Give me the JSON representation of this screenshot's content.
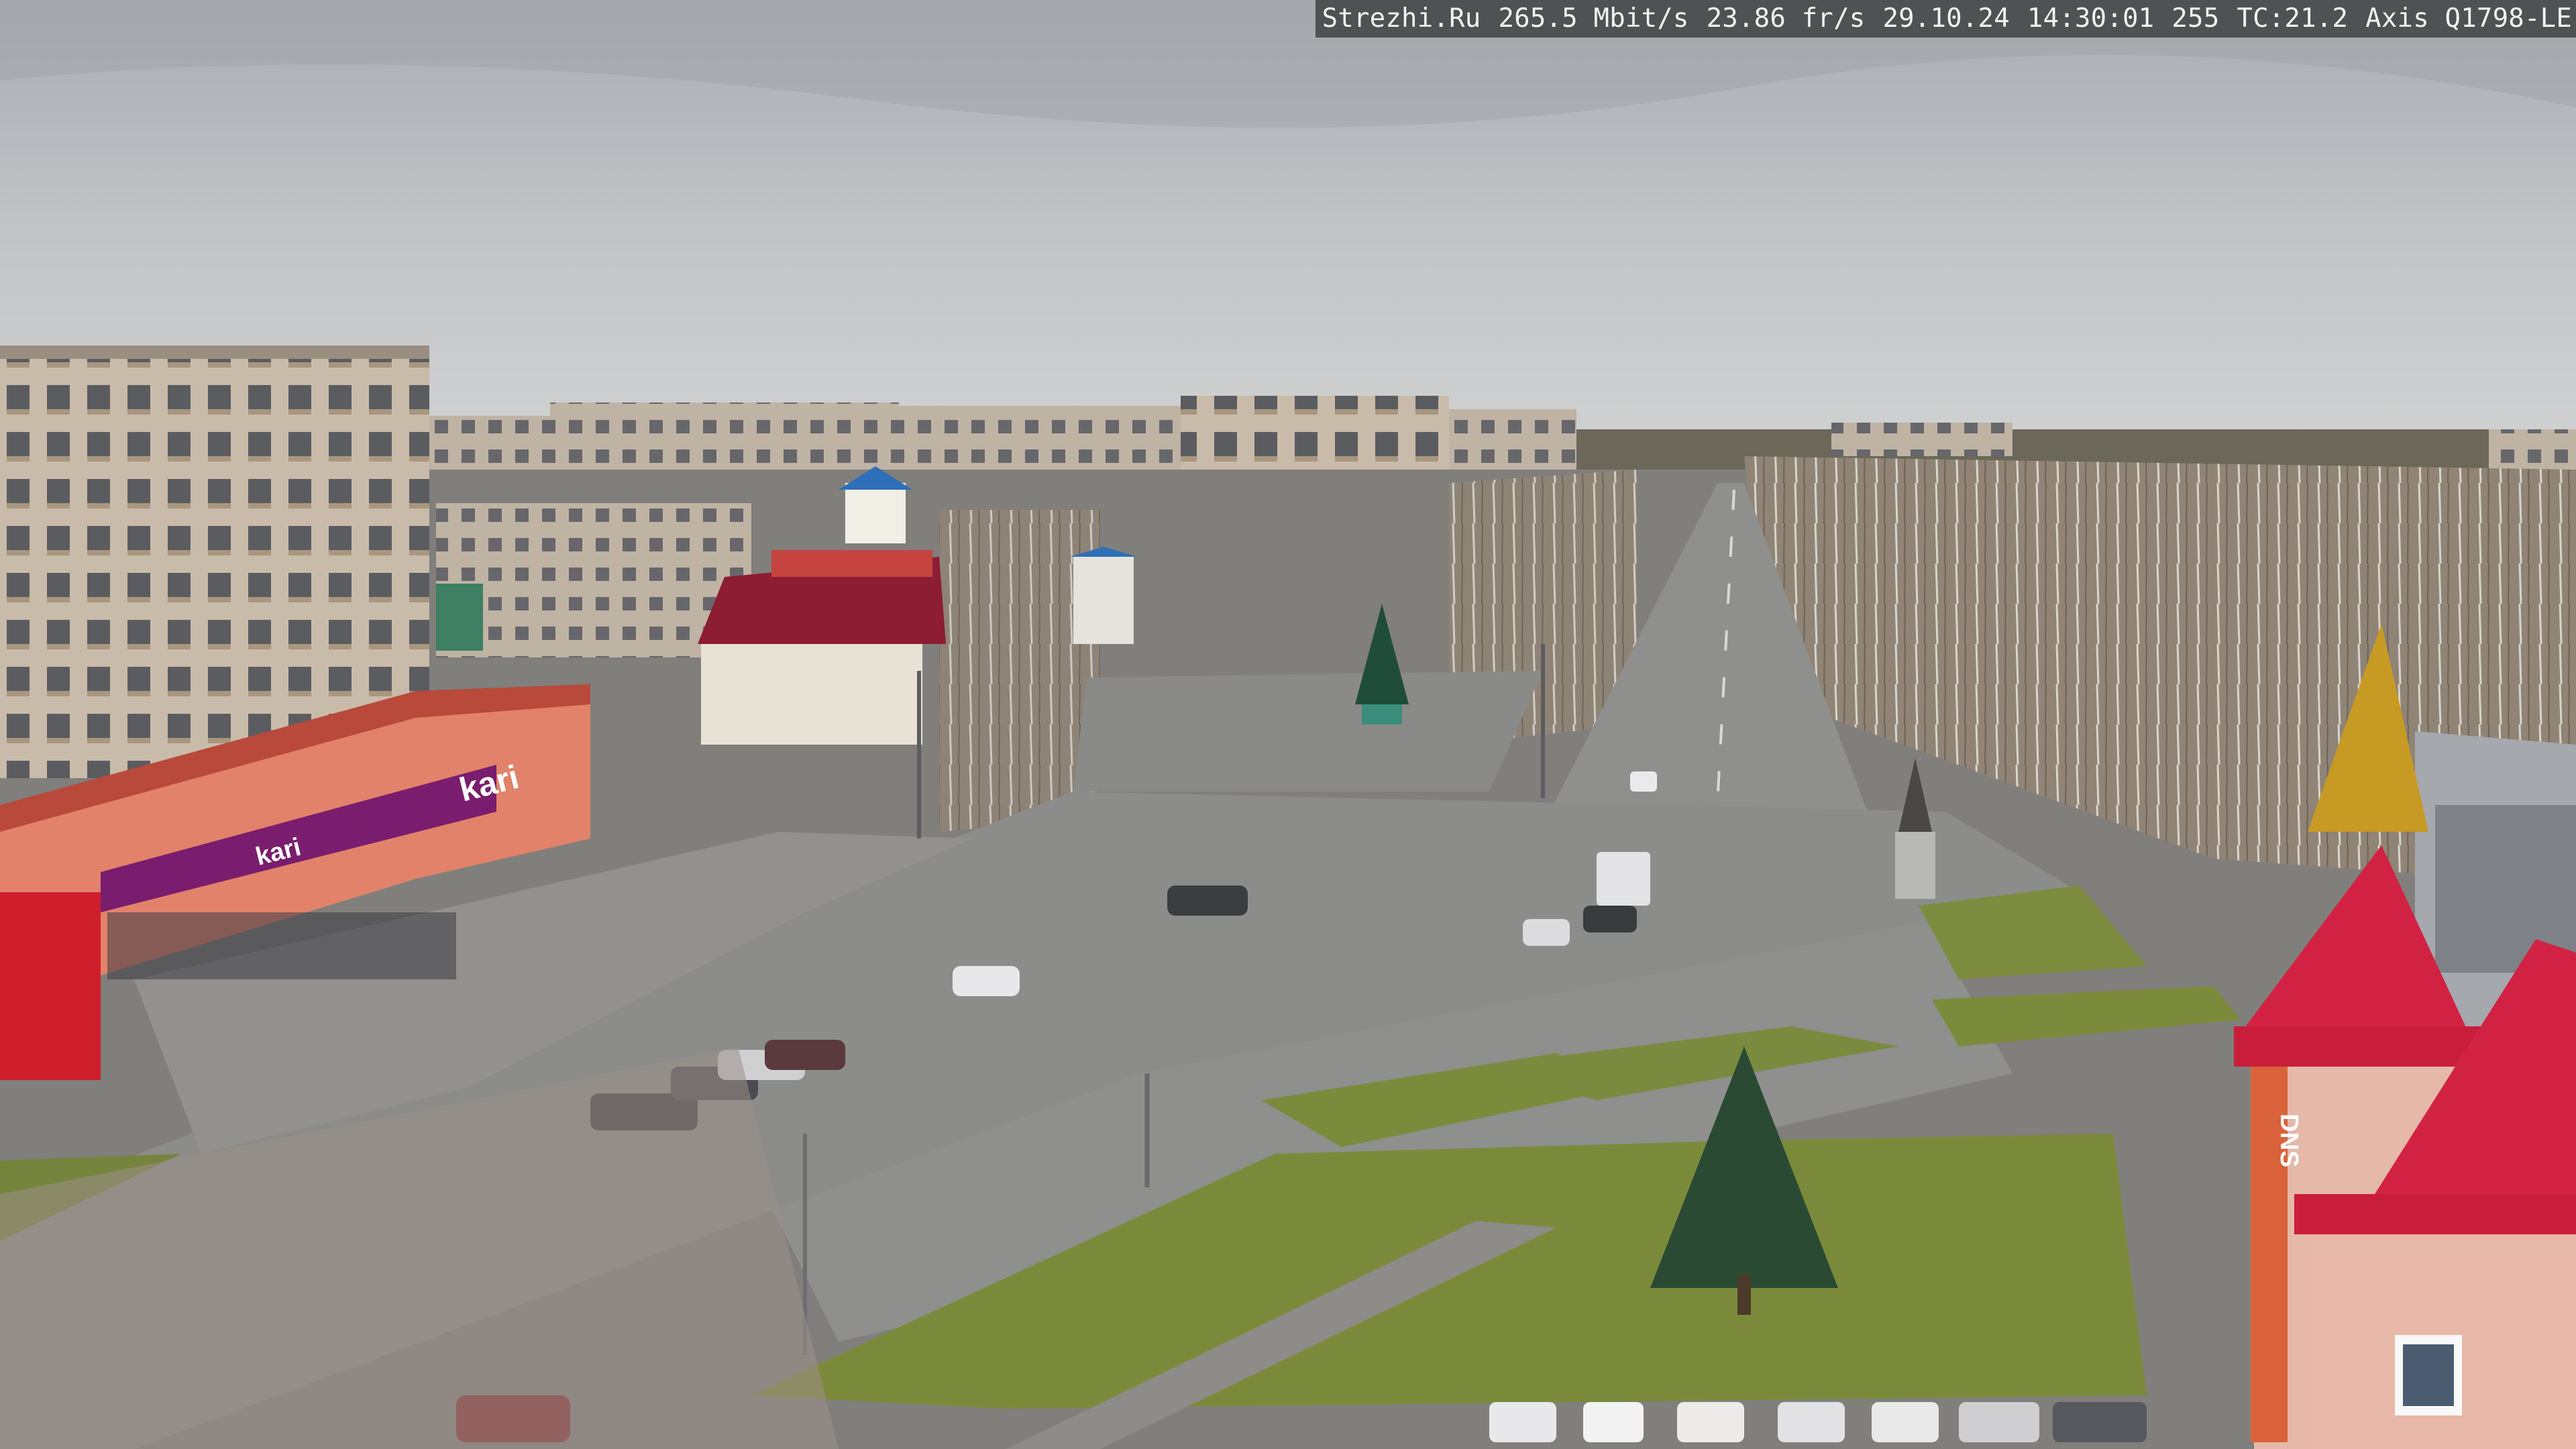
{
  "camera_overlay": {
    "site": "Strezhi.Ru",
    "bitrate": "265.5 Mbit/s",
    "framerate": "23.86 fr/s",
    "date": "29.10.24",
    "time": "14:30:01",
    "counter": "255",
    "temperature": "TC:21.2",
    "camera_model": "Axis Q1798-LE"
  },
  "storefront_signs": {
    "kari_large": "kari",
    "kari_small": "kari",
    "dns": "DNS"
  },
  "colors": {
    "sky": "#b9bcc0",
    "overlay_background": "#1a1a1a",
    "overlay_text": "#f2f2f2",
    "kari_brand": "#7a1d6e",
    "roof_red": "#c8283a",
    "facade_salmon": "#e2826a",
    "panel_building": "#c9bba9",
    "asphalt": "#8a8a8a",
    "grass": "#7c8a3c"
  }
}
